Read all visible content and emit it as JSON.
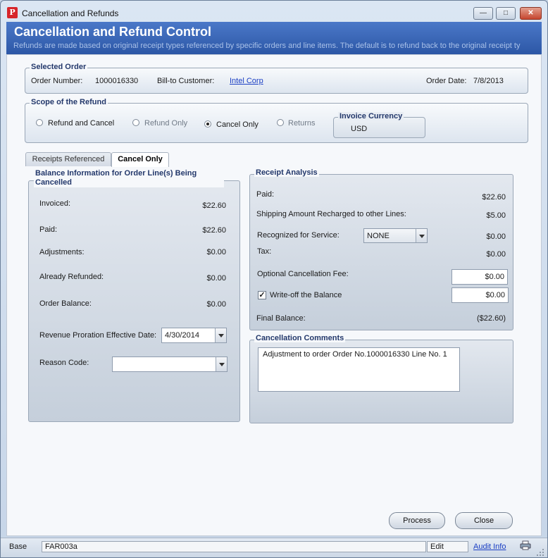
{
  "window": {
    "title": "Cancellation and Refunds",
    "minimize_symbol": "—",
    "maximize_symbol": "□",
    "close_symbol": "✕"
  },
  "header": {
    "title": "Cancellation and Refund Control",
    "subtitle": "Refunds are made based on original receipt types referenced by specific orders and line items. The default is to refund back to the original receipt ty"
  },
  "selected_order": {
    "group_title": "Selected Order",
    "order_number_label": "Order Number:",
    "order_number": "1000016330",
    "bill_to_label": "Bill-to Customer:",
    "bill_to_value": "Intel Corp",
    "order_date_label": "Order Date:",
    "order_date": "7/8/2013"
  },
  "scope": {
    "group_title": "Scope of the Refund",
    "options": [
      {
        "label": "Refund and Cancel",
        "checked": false,
        "enabled": true
      },
      {
        "label": "Refund Only",
        "checked": false,
        "enabled": false
      },
      {
        "label": "Cancel Only",
        "checked": true,
        "enabled": true
      },
      {
        "label": "Returns",
        "checked": false,
        "enabled": false
      }
    ],
    "invoice_currency_title": "Invoice Currency",
    "invoice_currency": "USD"
  },
  "tabs": [
    {
      "label": "Receipts Referenced",
      "active": false
    },
    {
      "label": "Cancel Only",
      "active": true
    }
  ],
  "balance_info": {
    "title": "Balance Information for Order Line(s) Being Cancelled",
    "invoiced_label": "Invoiced:",
    "invoiced": "$22.60",
    "paid_label": "Paid:",
    "paid": "$22.60",
    "adjustments_label": "Adjustments:",
    "adjustments": "$0.00",
    "already_refunded_label": "Already Refunded:",
    "already_refunded": "$0.00",
    "order_balance_label": "Order Balance:",
    "order_balance": "$0.00",
    "revenue_date_label": "Revenue Proration Effective Date:",
    "revenue_date": "4/30/2014",
    "reason_code_label": "Reason Code:",
    "reason_code": ""
  },
  "receipt_analysis": {
    "title": "Receipt  Analysis",
    "paid_label": "Paid:",
    "paid": "$22.60",
    "shipping_label": "Shipping Amount Recharged to other Lines:",
    "shipping": "$5.00",
    "recognized_label": "Recognized for Service:",
    "recognized_select": "NONE",
    "recognized": "$0.00",
    "tax_label": "Tax:",
    "tax": "$0.00",
    "cancel_fee_label": "Optional Cancellation Fee:",
    "cancel_fee": "$0.00",
    "writeoff_label": "Write-off the Balance",
    "writeoff_checked": true,
    "writeoff_mark": "✓",
    "writeoff": "$0.00",
    "final_balance_label": "Final Balance:",
    "final_balance": "($22.60)"
  },
  "comments": {
    "title": "Cancellation Comments",
    "text": "Adjustment to order Order No.1000016330 Line No.  1"
  },
  "buttons": {
    "process": "Process",
    "close": "Close"
  },
  "statusbar": {
    "base": "Base",
    "code": "FAR003a",
    "mode": "Edit",
    "audit": "Audit Info"
  }
}
